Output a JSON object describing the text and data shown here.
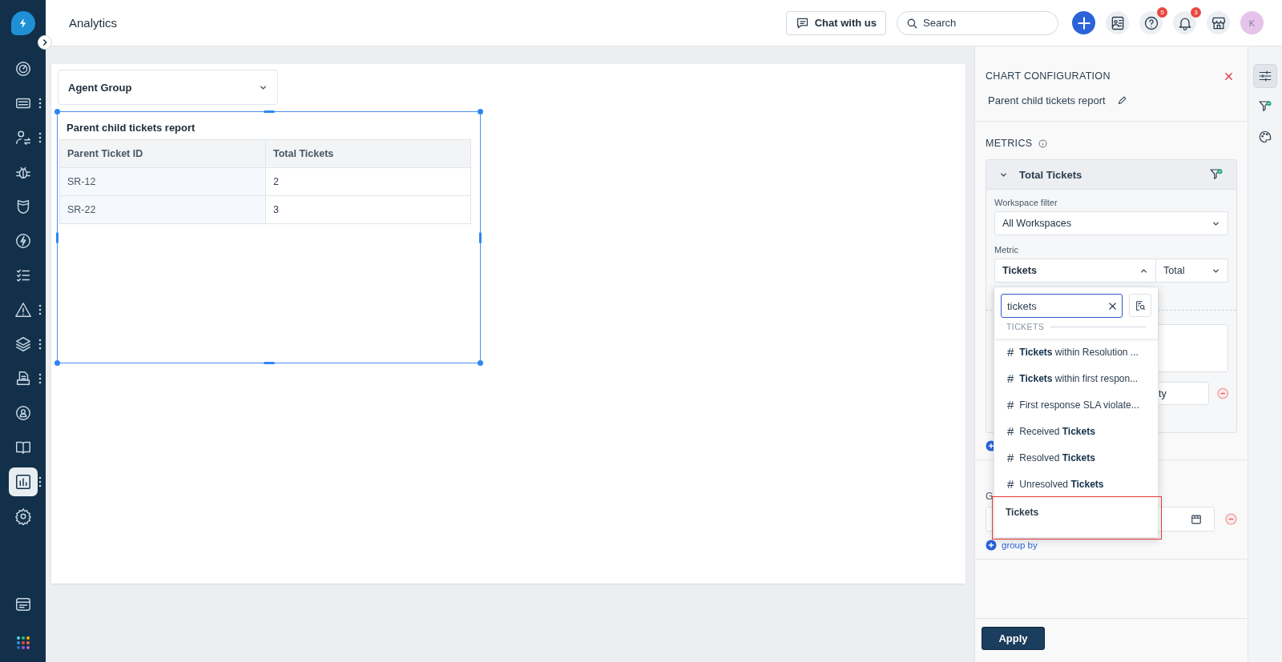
{
  "sidebar": {
    "items": [
      {
        "kind": "gauge",
        "has_menu": false,
        "selected": false
      },
      {
        "kind": "ticket",
        "has_menu": true,
        "selected": false
      },
      {
        "kind": "people",
        "has_menu": true,
        "selected": false
      },
      {
        "kind": "bug",
        "has_menu": false,
        "selected": false
      },
      {
        "kind": "shield",
        "has_menu": false,
        "selected": false
      },
      {
        "kind": "bolt",
        "has_menu": false,
        "selected": false
      },
      {
        "kind": "checklist",
        "has_menu": false,
        "selected": false
      },
      {
        "kind": "warning",
        "has_menu": true,
        "selected": false
      },
      {
        "kind": "layers",
        "has_menu": true,
        "selected": false
      },
      {
        "kind": "inbox",
        "has_menu": true,
        "selected": false
      },
      {
        "kind": "orbit",
        "has_menu": false,
        "selected": false
      },
      {
        "kind": "book",
        "has_menu": false,
        "selected": false
      },
      {
        "kind": "chart",
        "has_menu": true,
        "selected": true
      },
      {
        "kind": "gear",
        "has_menu": false,
        "selected": false
      }
    ],
    "bottom_items": [
      {
        "kind": "browser"
      },
      {
        "kind": "apps"
      }
    ]
  },
  "header": {
    "title": "Analytics",
    "chat_button": "Chat with us",
    "search": {
      "placeholder": "Search"
    },
    "actions": [
      {
        "kind": "add"
      },
      {
        "kind": "contacts"
      },
      {
        "kind": "help",
        "badge": "5"
      },
      {
        "kind": "bell",
        "badge": "3"
      },
      {
        "kind": "store"
      }
    ],
    "avatar": "K"
  },
  "canvas": {
    "filter": {
      "value": "Agent Group"
    },
    "widget": {
      "title": "Parent child tickets report",
      "selected": true,
      "table": {
        "columns": [
          "Parent Ticket ID",
          "Total Tickets"
        ],
        "rows": [
          [
            "SR-12",
            "2"
          ],
          [
            "SR-22",
            "3"
          ]
        ]
      }
    }
  },
  "panel": {
    "title": "CHART CONFIGURATION",
    "report_name": "Parent child tickets report",
    "metrics_label": "METRICS",
    "metric_card": {
      "title": "Total Tickets",
      "expanded": true,
      "workspace_label": "Workspace filter",
      "workspace_value": "All Workspaces",
      "metric_label": "Metric",
      "metric_value": "Tickets",
      "aggregation": "Total",
      "field_value": "ty"
    },
    "group_label": "G",
    "add_group_by": "group by",
    "apply": "Apply"
  },
  "metric_dropdown": {
    "open": true,
    "search_value": "tickets",
    "section": "TICKETS",
    "options": [
      {
        "kind": "metric",
        "icon": "#",
        "label": "**Tickets** within Resolution ...",
        "highlighted": false
      },
      {
        "kind": "metric",
        "icon": "#",
        "label": "**Tickets** within first respon...",
        "highlighted": false
      },
      {
        "kind": "metric",
        "icon": "#",
        "label": "First response SLA violate...",
        "highlighted": false
      },
      {
        "kind": "metric",
        "icon": "#",
        "label": "Received **Tickets**",
        "highlighted": false
      },
      {
        "kind": "metric",
        "icon": "#",
        "label": "Resolved **Tickets**",
        "highlighted": false
      },
      {
        "kind": "metric",
        "icon": "#",
        "label": "Unresolved **Tickets**",
        "highlighted": false
      },
      {
        "kind": "field",
        "label": "Tickets",
        "highlighted": true
      }
    ]
  },
  "tool_strip": [
    {
      "kind": "settings",
      "selected": true
    },
    {
      "kind": "filter",
      "selected": false
    },
    {
      "kind": "palette",
      "selected": false
    }
  ]
}
